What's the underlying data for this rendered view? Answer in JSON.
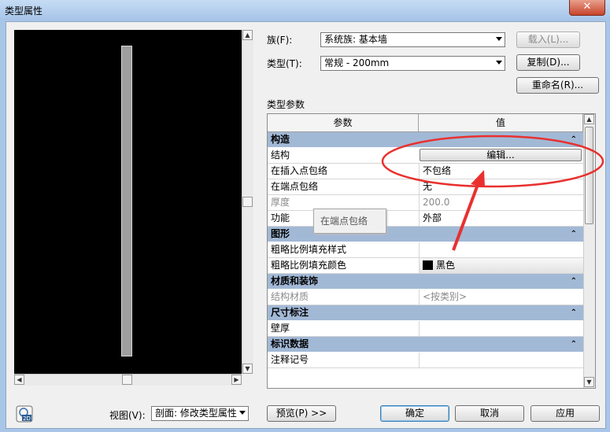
{
  "window": {
    "title": "类型属性",
    "close_glyph": "✕"
  },
  "family": {
    "label": "族(F):",
    "value": "系统族: 基本墙"
  },
  "type": {
    "label": "类型(T):",
    "value": "常规 - 200mm"
  },
  "buttons": {
    "load": "载入(L)...",
    "duplicate": "复制(D)...",
    "rename": "重命名(R)...",
    "preview": "预览(P) >>",
    "ok": "确定",
    "cancel": "取消",
    "apply": "应用"
  },
  "type_params_label": "类型参数",
  "grid": {
    "col_param": "参数",
    "col_value": "值",
    "groups": [
      {
        "name": "构造",
        "rows": [
          {
            "k": "结构",
            "v": "编辑...",
            "kind": "button"
          },
          {
            "k": "在插入点包络",
            "v": "不包络"
          },
          {
            "k": "在端点包络",
            "v": "无"
          },
          {
            "k": "厚度",
            "v": "200.0",
            "dim": true
          },
          {
            "k": "功能",
            "v": "外部"
          }
        ]
      },
      {
        "name": "图形",
        "rows": [
          {
            "k": "粗略比例填充样式",
            "v": ""
          },
          {
            "k": "粗略比例填充颜色",
            "v": "黑色",
            "kind": "color"
          }
        ]
      },
      {
        "name": "材质和装饰",
        "rows": [
          {
            "k": "结构材质",
            "v": "<按类别>",
            "dim": true
          }
        ]
      },
      {
        "name": "尺寸标注",
        "rows": [
          {
            "k": "壁厚",
            "v": ""
          }
        ]
      },
      {
        "name": "标识数据",
        "rows": [
          {
            "k": "注释记号",
            "v": ""
          }
        ]
      }
    ]
  },
  "tooltip": "在端点包络",
  "view": {
    "label": "视图(V):",
    "value": "剖面: 修改类型属性"
  },
  "icons": {
    "collapse": "⌃",
    "view2d": "2D"
  },
  "colors": {
    "annotation": "#e8312f",
    "group_bg": "#a2b9d6"
  }
}
